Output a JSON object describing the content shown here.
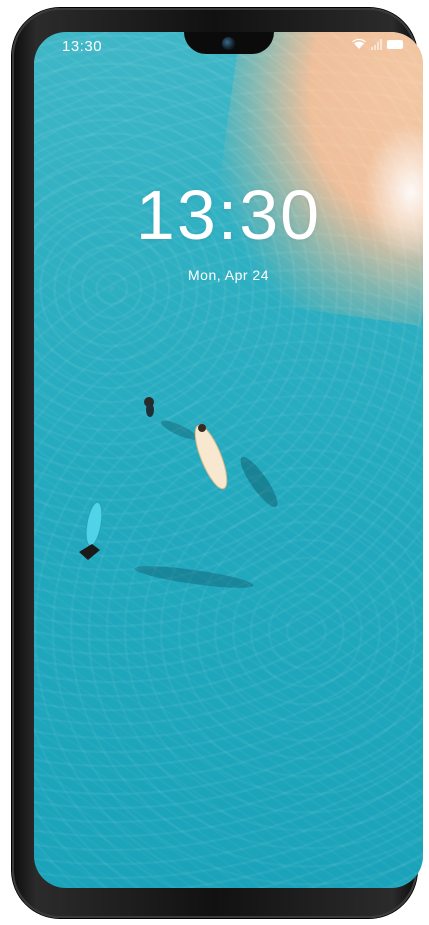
{
  "status_bar": {
    "time": "13:30",
    "icons": [
      "wifi-icon",
      "signal-icon",
      "battery-icon"
    ]
  },
  "lock_screen": {
    "clock": "13:30",
    "date": "Mon, Apr 24"
  },
  "colors": {
    "water": "#22a9be",
    "sand": "#efbf9a",
    "frame": "#111111"
  }
}
